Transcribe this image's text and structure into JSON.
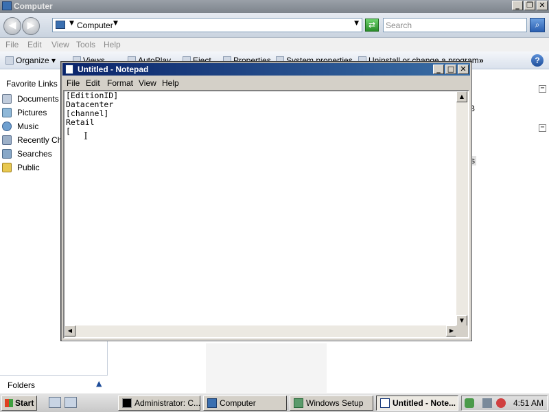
{
  "explorer": {
    "title": "Computer",
    "address": "Computer",
    "search_placeholder": "Search",
    "menu": [
      "File",
      "Edit",
      "View",
      "Tools",
      "Help"
    ],
    "toolbar": {
      "organize": "Organize",
      "views": "Views",
      "autoplay": "AutoPlay",
      "eject": "Eject",
      "properties": "Properties",
      "system_properties": "System properties",
      "uninstall": "Uninstall or change a program",
      "more": "»"
    },
    "sidebar": {
      "header": "Favorite Links",
      "items": [
        {
          "label": "Documents"
        },
        {
          "label": "Pictures"
        },
        {
          "label": "Music"
        },
        {
          "label": "Recently Changed"
        },
        {
          "label": "Searches"
        },
        {
          "label": "Public"
        }
      ],
      "folders_label": "Folders"
    },
    "content_fragments": {
      "frag1": "B",
      "frag2": "s"
    }
  },
  "notepad": {
    "title": "Untitled - Notepad",
    "menu": [
      "File",
      "Edit",
      "Format",
      "View",
      "Help"
    ],
    "text": "[EditionID]\nDatacenter\n[channel]\nRetail",
    "current_line": "["
  },
  "taskbar": {
    "start_label": "Start",
    "tasks": [
      {
        "label": "Administrator: C..."
      },
      {
        "label": "Computer"
      },
      {
        "label": "Windows Setup"
      },
      {
        "label": "Untitled - Note..."
      }
    ],
    "clock": "4:51 AM"
  },
  "colors": {
    "notepad_title_start": "#0a246a",
    "notepad_title_end": "#3a6ea5",
    "explorer_title": "#8a9098"
  },
  "icons": [
    "computer-icon",
    "back-arrow-icon",
    "forward-arrow-icon",
    "refresh-icon",
    "search-icon",
    "help-icon",
    "notepad-icon",
    "windows-flag-icon"
  ]
}
